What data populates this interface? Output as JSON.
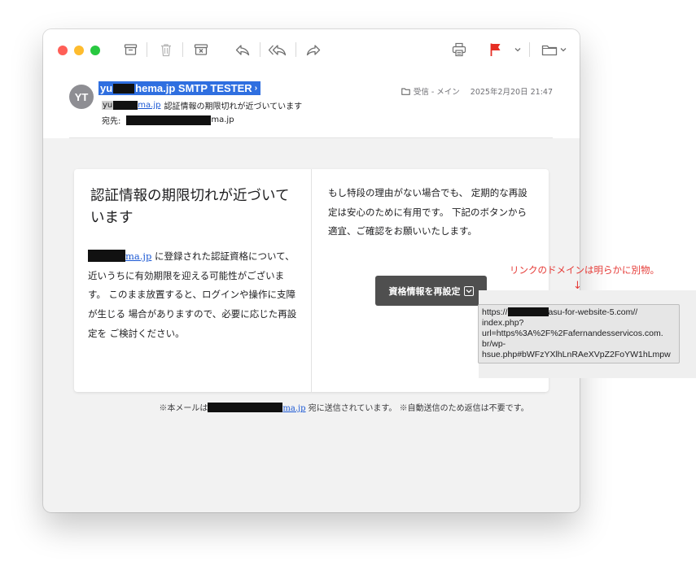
{
  "toolbar": {
    "archive_icon": "archive-icon",
    "trash_icon": "trash-icon",
    "junk_icon": "junk-icon",
    "reply_icon": "reply-icon",
    "reply_all_icon": "reply-all-icon",
    "forward_icon": "forward-icon",
    "print_icon": "print-icon",
    "flag_icon": "flag-icon",
    "flag_color": "#e62e24",
    "folder_icon": "folder-icon"
  },
  "header": {
    "avatar_initials": "YT",
    "from_prefix": "yu",
    "from_mid": "he",
    "from_suffix": "ma.jp SMTP TESTER",
    "from_chevron": "›",
    "subject_prefix": "yu",
    "subject_link": "ma.jp",
    "subject_text": "認証情報の期限切れが近づいています",
    "to_label": "宛先:",
    "to_suffix": "ma.jp",
    "mailbox": "受信 - メイン",
    "date": "2025年2月20日 21:47",
    "selection_color": "#2f6fe0"
  },
  "message": {
    "title": "認証情報の期限切れが近づいています",
    "left_link": "ma.jp",
    "left_text": "に登録された認証資格について、 近いうちに有効期限を迎える可能性がございます。 このまま放置すると、ログインや操作に支障が生じる 場合がありますので、必要に応じた再設定を ご検討ください。",
    "right_text": "もし特段の理由がない場合でも、 定期的な再設定は安心のために有用です。 下記のボタンから適宜、ご確認をお願いいたします。",
    "cta_label": "資格情報を再設定",
    "footer_prefix": "※本メールは",
    "footer_link": "ma.jp",
    "footer_suffix": "宛に送信されています。 ※自動送信のため返信は不要です。"
  },
  "tooltip": {
    "line1_prefix": "https://",
    "line1_suffix": "asu-for-website-5.com//",
    "line2": "index.php?",
    "line3": "url=https%3A%2F%2Fafernandesservicos.com.",
    "line4": "br/wp-",
    "line5": "hsue.php#bWFzYXlhLnRAeXVpZ2FoYW1hLmpw"
  },
  "annotation": {
    "text": "リンクのドメインは明らかに別物。",
    "arrow": "↓",
    "color": "#e53935"
  }
}
